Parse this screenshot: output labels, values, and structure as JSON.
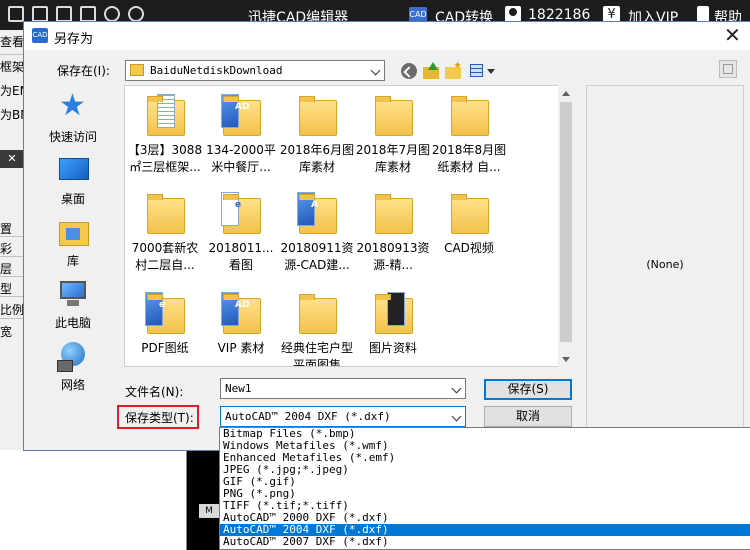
{
  "app": {
    "title": "迅捷CAD编辑器",
    "cad_badge": "CAD",
    "cad_convert": "CAD转换",
    "user_id": "1822186",
    "vip_symbol": "¥",
    "vip_label": "加入VIP",
    "help_label": "帮助",
    "left_strip": [
      "查看",
      "框架",
      "为EM",
      "为BM",
      "置",
      "彩",
      "层",
      "型",
      "比例",
      "宽"
    ],
    "left_close": "✕",
    "bottom_tab": "M"
  },
  "dialog": {
    "icon_text": "CAD",
    "title": "另存为",
    "close": "✕",
    "save_in_label": "保存在(I):",
    "save_in_value": "BaiduNetdiskDownload",
    "places": [
      {
        "label": "快速访问",
        "icon": "quick-access-star-icon"
      },
      {
        "label": "桌面",
        "icon": "desktop-icon"
      },
      {
        "label": "库",
        "icon": "library-icon"
      },
      {
        "label": "此电脑",
        "icon": "this-pc-icon"
      },
      {
        "label": "网络",
        "icon": "network-icon"
      }
    ],
    "files": [
      {
        "label": "【3层】3088㎡三层框架...",
        "kind": "folder-doc-green"
      },
      {
        "label": "134-2000平米中餐厅...",
        "kind": "folder-doc-blue"
      },
      {
        "label": "2018年6月图库素材",
        "kind": "folder"
      },
      {
        "label": "2018年7月图库素材",
        "kind": "folder"
      },
      {
        "label": "2018年8月图纸素材 自...",
        "kind": "folder"
      },
      {
        "label": "7000套新农村二层自...",
        "kind": "folder"
      },
      {
        "label": "2018011...看图",
        "kind": "folder-doc-white"
      },
      {
        "label": "20180911资源-CAD建...",
        "kind": "folder-doc-blue"
      },
      {
        "label": "20180913资源-精...",
        "kind": "folder"
      },
      {
        "label": "CAD视频",
        "kind": "folder"
      },
      {
        "label": "PDF图纸",
        "kind": "folder-doc-blue"
      },
      {
        "label": "VIP 素材",
        "kind": "folder-doc-blue"
      },
      {
        "label": "经典住宅户型平面图集",
        "kind": "folder"
      },
      {
        "label": "图片资料",
        "kind": "folder-doc-dark"
      }
    ],
    "preview_none": "(None)",
    "filename_label": "文件名(N):",
    "filename_value": "New1",
    "filetype_label": "保存类型(T):",
    "filetype_value": "AutoCAD™ 2004 DXF (*.dxf)",
    "save_button": "保存(S)",
    "cancel_button": "取消",
    "filetype_options": [
      "Bitmap Files (*.bmp)",
      "Windows Metafiles (*.wmf)",
      "Enhanced Metafiles (*.emf)",
      "JPEG (*.jpg;*.jpeg)",
      "GIF (*.gif)",
      "PNG (*.png)",
      "TIFF (*.tif;*.tiff)",
      "AutoCAD™ 2000 DXF (*.dxf)",
      "AutoCAD™ 2004 DXF (*.dxf)",
      "AutoCAD™ 2007 DXF (*.dxf)"
    ],
    "selected_option_index": 8
  },
  "colors": {
    "selection": "#0078d7",
    "highlight_box": "#e02020",
    "titlebar_dark": "#1d1d1d"
  }
}
